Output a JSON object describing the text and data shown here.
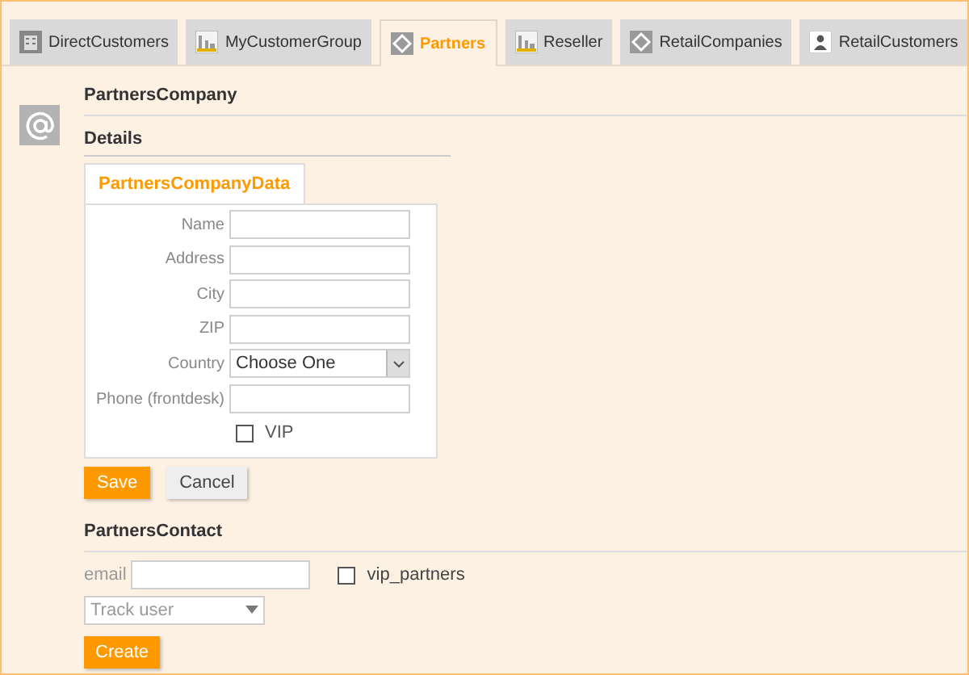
{
  "tabs": [
    {
      "label": "DirectCustomers",
      "selected": false
    },
    {
      "label": "MyCustomerGroup",
      "selected": false
    },
    {
      "label": "Partners",
      "selected": true
    },
    {
      "label": "Reseller",
      "selected": false
    },
    {
      "label": "RetailCompanies",
      "selected": false
    },
    {
      "label": "RetailCustomers",
      "selected": false
    }
  ],
  "company": {
    "title": "PartnersCompany",
    "subtitle": "Details",
    "inner_tab": {
      "label": "PartnersCompanyData",
      "selected": true
    },
    "fields": [
      {
        "kind": "text",
        "label": "Name"
      },
      {
        "kind": "text",
        "label": "Address"
      },
      {
        "kind": "text",
        "label": "City"
      },
      {
        "kind": "text",
        "label": "ZIP"
      },
      {
        "kind": "select",
        "label": "Country",
        "value": "Choose One"
      },
      {
        "kind": "text",
        "label": "Phone (frontdesk)"
      },
      {
        "kind": "checkbox",
        "label": "VIP",
        "checked": false
      }
    ],
    "buttons": [
      {
        "kind": "primary",
        "label": "Save"
      },
      {
        "kind": "secondary",
        "label": "Cancel"
      }
    ]
  },
  "contact": {
    "title": "PartnersContact",
    "email_label": "email",
    "checkbox": {
      "label": "vip_partners",
      "checked": false
    },
    "select": {
      "placeholder": "Track user"
    },
    "button": {
      "label": "Create"
    }
  }
}
